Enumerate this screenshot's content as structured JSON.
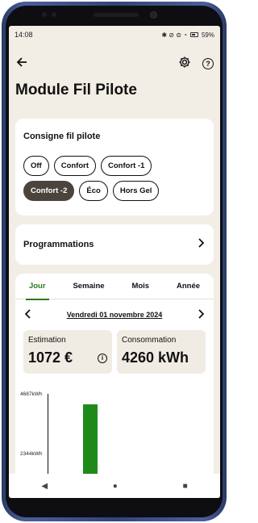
{
  "status": {
    "time": "14:08",
    "icons": "✱ ⊘ ⊜ ◔",
    "battery": "59%"
  },
  "header": {
    "back_icon": "arrow-left-icon",
    "settings_icon": "gear-icon",
    "help_icon": "help-icon",
    "help_glyph": "?"
  },
  "page": {
    "title": "Module Fil Pilote"
  },
  "consigne": {
    "title": "Consigne fil pilote",
    "options": [
      "Off",
      "Confort",
      "Confort -1",
      "Confort -2",
      "Éco",
      "Hors Gel"
    ],
    "selected": "Confort -2"
  },
  "programmations": {
    "label": "Programmations"
  },
  "tabs": [
    "Jour",
    "Semaine",
    "Mois",
    "Année"
  ],
  "active_tab": "Jour",
  "date": {
    "label": "Vendredi 01 novembre 2024"
  },
  "estimation": {
    "label": "Estimation",
    "value": "1072 €"
  },
  "consommation": {
    "label": "Consommation",
    "value": "4260 kWh"
  },
  "chart_data": {
    "type": "bar",
    "y_ticks": [
      "4687kWh",
      "2344kWh"
    ],
    "bars": [
      {
        "value": 4260
      }
    ],
    "ylim": [
      0,
      4687
    ],
    "color": "#1f8a1a"
  },
  "nav": {
    "back": "◀",
    "home": "●",
    "recents": "■"
  },
  "colors": {
    "accent": "#2a7a1a",
    "active_chip": "#4a443d",
    "background": "#f2eee6"
  }
}
